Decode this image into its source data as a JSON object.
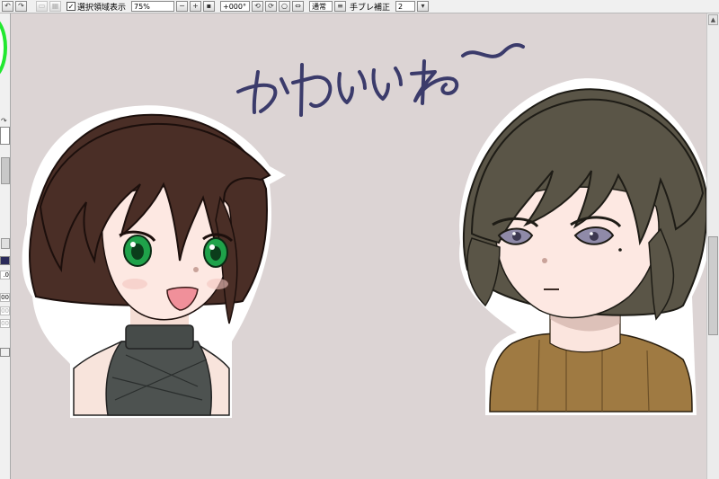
{
  "toolbar": {
    "show_selection_label": "選択領域表示",
    "show_selection_checked": "✓",
    "zoom_value": "75%",
    "rotation_value": "+000°",
    "blend_mode": "通常",
    "stabilizer_label": "手ブレ補正",
    "stabilizer_value": "2"
  },
  "leftpanel": {
    "value_a": "00",
    "value_b": ".0",
    "value_c": "00",
    "value_d": "00",
    "value_e": "00"
  },
  "canvas": {
    "handwriting": "かわいいね〜",
    "handwriting_color": "#3b3b6b",
    "background_color": "#dcd4d4"
  },
  "icons": [
    "undo-icon",
    "redo-icon",
    "deselect-icon",
    "invert-selection-icon",
    "zoom-out-icon",
    "zoom-in-icon",
    "zoom-reset-icon",
    "rotate-left-icon",
    "rotate-right-icon",
    "rotate-reset-icon",
    "flip-icon",
    "mode-dropdown-icon",
    "stabilizer-dropdown-icon"
  ]
}
